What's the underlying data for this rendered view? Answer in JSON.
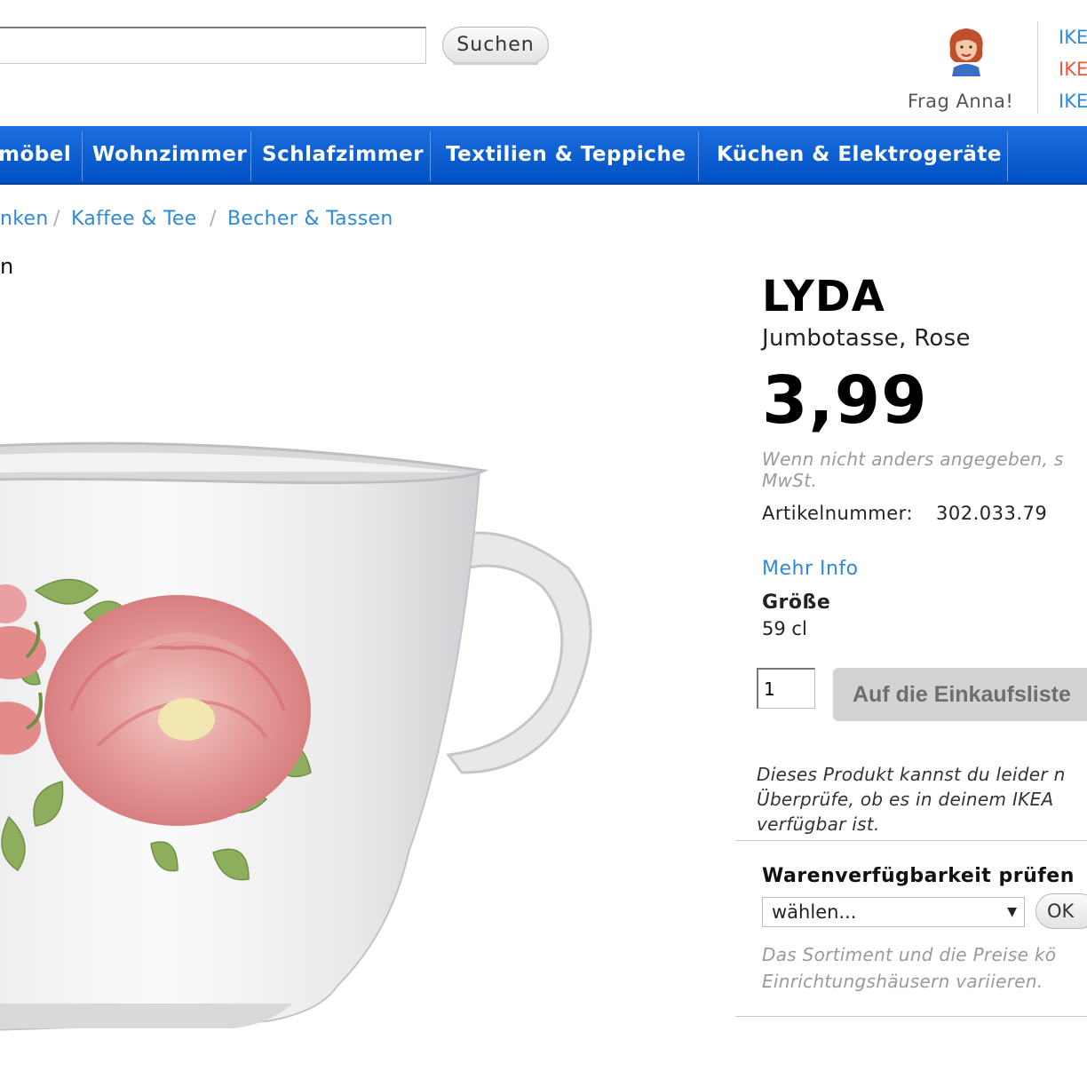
{
  "header": {
    "search": {
      "value": "",
      "placeholder": ""
    },
    "search_button_label": "Suchen",
    "assistant_label": "Frag Anna!",
    "side_links": [
      {
        "label": "IKE",
        "color": "#2e8ad8"
      },
      {
        "label": "IKE",
        "color": "#e8583a"
      },
      {
        "label": "IKE",
        "color": "#2e8ad8"
      }
    ]
  },
  "nav": {
    "items": [
      {
        "label": "möbel"
      },
      {
        "label": "Wohnzimmer"
      },
      {
        "label": "Schlafzimmer"
      },
      {
        "label": "Textilien & Teppiche"
      },
      {
        "label": "Küchen & Elektrogeräte"
      }
    ],
    "color": "#0058cc"
  },
  "breadcrumb": {
    "items": [
      {
        "label": "nken"
      },
      {
        "label": "Kaffee & Tee"
      },
      {
        "label": "Becher & Tassen"
      }
    ],
    "separator": "/"
  },
  "left_heading_fragment": "n",
  "product": {
    "name": "LYDA",
    "description": "Jumbotasse, Rose",
    "price": "3,99",
    "vat_note_line1": "Wenn nicht anders angegeben, s",
    "vat_note_line2": "MwSt.",
    "article_label": "Artikelnummer:",
    "article_number": "302.033.79",
    "more_info_label": "Mehr Info",
    "size_label": "Größe",
    "size_value": "59 cl",
    "quantity": "1",
    "add_to_list_label": "Auf die Einkaufsliste",
    "unavailable_lines": [
      "Dieses Produkt kannst du leider n",
      "Überprüfe, ob es in deinem IKEA",
      "verfügbar ist."
    ]
  },
  "stock_check": {
    "title": "Warenverfügbarkeit prüfen",
    "store_select_value": "wählen...",
    "ok_label": "OK",
    "note_lines": [
      "Das Sortiment und die Preise kö",
      "Einrichtungshäusern variieren."
    ]
  },
  "image": {
    "subject": "white mug with pink rose print",
    "icon": "product-image"
  }
}
